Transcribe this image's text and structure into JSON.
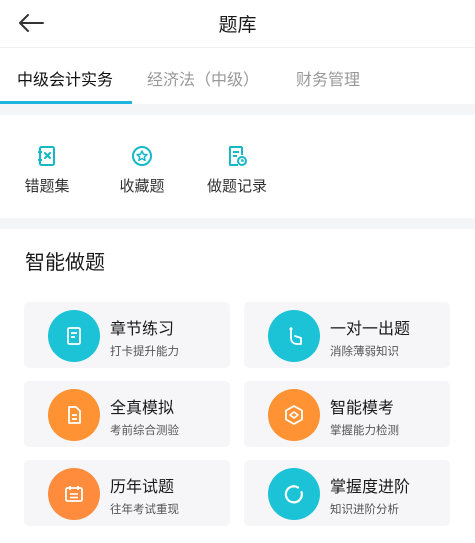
{
  "header": {
    "title": "题库",
    "back_icon": "arrow-left-icon"
  },
  "tabs": [
    {
      "label": "中级会计实务",
      "active": true
    },
    {
      "label": "经济法（中级）",
      "active": false
    },
    {
      "label": "财务管理",
      "active": false
    }
  ],
  "quick_actions": [
    {
      "label": "错题集",
      "icon": "wrong-book-icon"
    },
    {
      "label": "收藏题",
      "icon": "star-circle-icon"
    },
    {
      "label": "做题记录",
      "icon": "record-icon"
    }
  ],
  "smart_practice": {
    "title": "智能做题",
    "cards": [
      {
        "title": "章节练习",
        "subtitle": "打卡提升能力",
        "icon": "document-icon",
        "color": "#1cc3d6"
      },
      {
        "title": "一对一出题",
        "subtitle": "消除薄弱知识",
        "icon": "pen-hand-icon",
        "color": "#1cc3d6"
      },
      {
        "title": "全真模拟",
        "subtitle": "考前综合测验",
        "icon": "paper-icon",
        "color": "#ff9232"
      },
      {
        "title": "智能模考",
        "subtitle": "掌握能力检测",
        "icon": "hexagon-icon",
        "color": "#ff9232"
      },
      {
        "title": "历年试题",
        "subtitle": "往年考试重现",
        "icon": "calendar-icon",
        "color": "#ff8b3d"
      },
      {
        "title": "掌握度进阶",
        "subtitle": "知识进阶分析",
        "icon": "progress-ring-icon",
        "color": "#1cc3d6"
      }
    ]
  },
  "colors": {
    "accent": "#1fb4de",
    "icon_teal": "#14b8c8",
    "separator": "#f4f5f7"
  }
}
